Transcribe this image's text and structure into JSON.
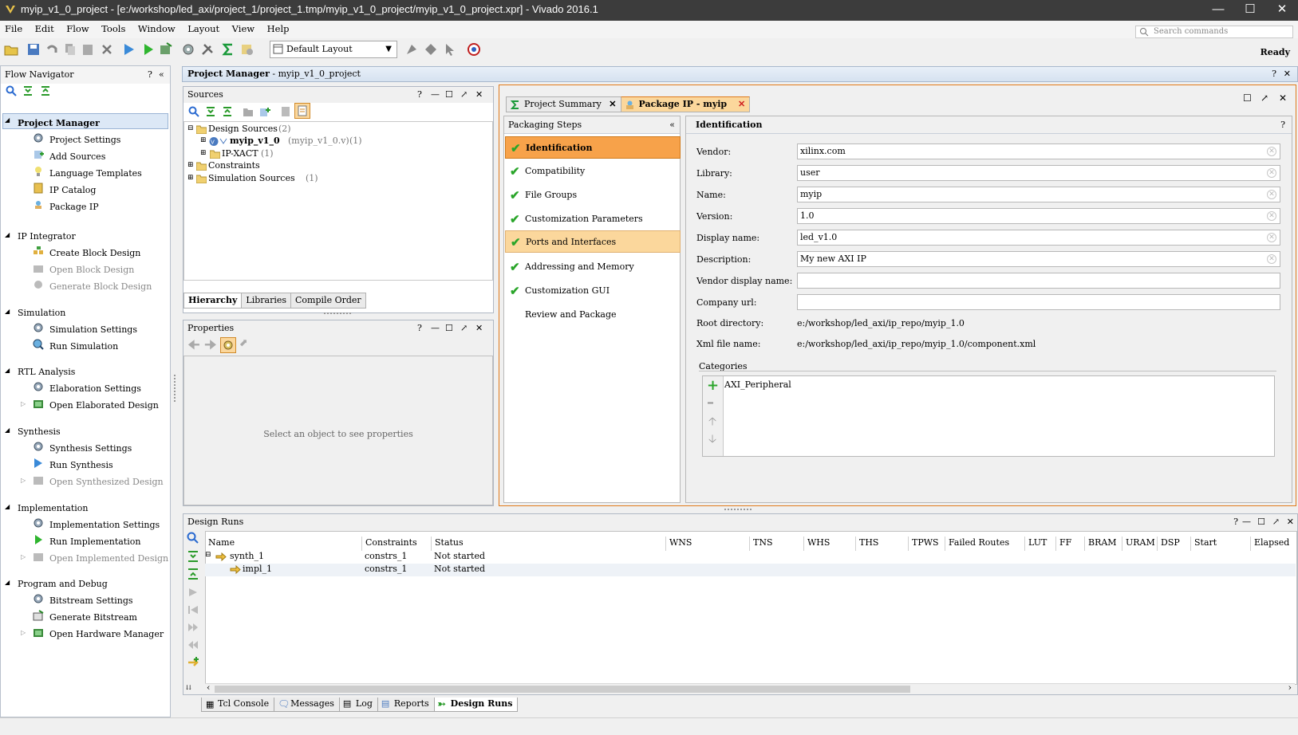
{
  "window": {
    "title": "myip_v1_0_project - [e:/workshop/led_axi/project_1/project_1.tmp/myip_v1_0_project/myip_v1_0_project.xpr] - Vivado 2016.1"
  },
  "menu": [
    "File",
    "Edit",
    "Flow",
    "Tools",
    "Window",
    "Layout",
    "View",
    "Help"
  ],
  "search": {
    "placeholder": "Search commands"
  },
  "toolbar": {
    "layout": "Default Layout",
    "status": "Ready"
  },
  "flow_navigator": {
    "title": "Flow Navigator",
    "sections": [
      {
        "label": "Project Manager",
        "items": [
          "Project Settings",
          "Add Sources",
          "Language Templates",
          "IP Catalog",
          "Package IP"
        ]
      },
      {
        "label": "IP Integrator",
        "items": [
          "Create Block Design",
          "Open Block Design",
          "Generate Block Design"
        ]
      },
      {
        "label": "Simulation",
        "items": [
          "Simulation Settings",
          "Run Simulation"
        ]
      },
      {
        "label": "RTL Analysis",
        "items": [
          "Elaboration Settings",
          "Open Elaborated Design"
        ]
      },
      {
        "label": "Synthesis",
        "items": [
          "Synthesis Settings",
          "Run Synthesis",
          "Open Synthesized Design"
        ]
      },
      {
        "label": "Implementation",
        "items": [
          "Implementation Settings",
          "Run Implementation",
          "Open Implemented Design"
        ]
      },
      {
        "label": "Program and Debug",
        "items": [
          "Bitstream Settings",
          "Generate Bitstream",
          "Open Hardware Manager"
        ]
      }
    ]
  },
  "project_manager": {
    "title": "Project Manager",
    "project": "myip_v1_0_project"
  },
  "sources": {
    "title": "Sources",
    "tree": {
      "design_sources": "Design Sources",
      "design_sources_count": "(2)",
      "top_module": "myip_v1_0",
      "top_file": "(myip_v1_0.v)",
      "top_count": "(1)",
      "ipxact": "IP-XACT",
      "ipxact_count": "(1)",
      "constraints": "Constraints",
      "sim_sources": "Simulation Sources",
      "sim_sources_count": "(1)"
    },
    "tabs": [
      "Hierarchy",
      "Libraries",
      "Compile Order"
    ]
  },
  "properties": {
    "title": "Properties",
    "empty": "Select an object to see properties"
  },
  "editor_tabs": [
    "Project Summary",
    "Package IP - myip"
  ],
  "packaging": {
    "title": "Packaging Steps",
    "steps": [
      "Identification",
      "Compatibility",
      "File Groups",
      "Customization Parameters",
      "Ports and Interfaces",
      "Addressing and Memory",
      "Customization GUI",
      "Review and Package"
    ]
  },
  "identification": {
    "title": "Identification",
    "labels": {
      "vendor": "Vendor:",
      "library": "Library:",
      "name": "Name:",
      "version": "Version:",
      "display_name": "Display name:",
      "description": "Description:",
      "vendor_display_name": "Vendor display name:",
      "company_url": "Company url:",
      "root_directory": "Root directory:",
      "xml_file_name": "Xml file name:"
    },
    "values": {
      "vendor": "xilinx.com",
      "library": "user",
      "name": "myip",
      "version": "1.0",
      "display_name": "led_v1.0",
      "description": "My new AXI IP",
      "vendor_display_name": "",
      "company_url": "",
      "root_directory": "e:/workshop/led_axi/ip_repo/myip_1.0",
      "xml_file_name": "e:/workshop/led_axi/ip_repo/myip_1.0/component.xml"
    },
    "categories_label": "Categories",
    "categories": [
      "AXI_Peripheral"
    ]
  },
  "design_runs": {
    "title": "Design Runs",
    "columns": [
      "Name",
      "Constraints",
      "Status",
      "WNS",
      "TNS",
      "WHS",
      "THS",
      "TPWS",
      "Failed Routes",
      "LUT",
      "FF",
      "BRAM",
      "URAM",
      "DSP",
      "Start",
      "Elapsed"
    ],
    "rows": [
      {
        "name": "synth_1",
        "constraints": "constrs_1",
        "status": "Not started"
      },
      {
        "name": "impl_1",
        "constraints": "constrs_1",
        "status": "Not started"
      }
    ]
  },
  "bottom_tabs": [
    "Tcl Console",
    "Messages",
    "Log",
    "Reports",
    "Design Runs"
  ],
  "colors": {
    "accent": "#f7a24a",
    "selected_step": "#fbd79c",
    "check": "#2aa52a"
  }
}
